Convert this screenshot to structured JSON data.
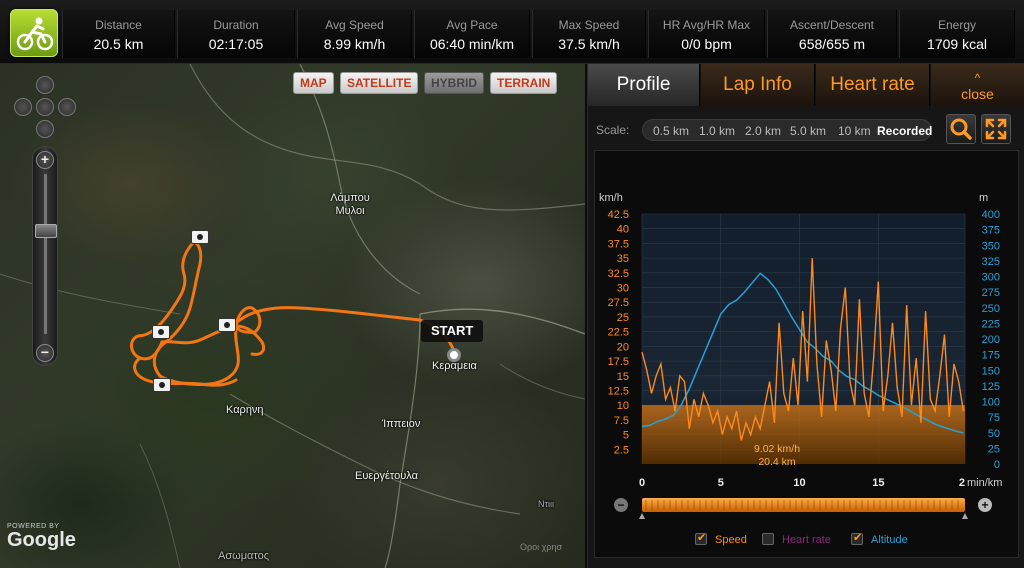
{
  "stats": [
    {
      "label": "Distance",
      "value": "20.5 km"
    },
    {
      "label": "Duration",
      "value": "02:17:05"
    },
    {
      "label": "Avg Speed",
      "value": "8.99 km/h"
    },
    {
      "label": "Avg Pace",
      "value": "06:40 min/km"
    },
    {
      "label": "Max Speed",
      "value": "37.5 km/h"
    },
    {
      "label": "HR Avg/HR Max",
      "value": "0/0 bpm"
    },
    {
      "label": "Ascent/Descent",
      "value": "658/655 m"
    },
    {
      "label": "Energy",
      "value": "1709 kcal"
    }
  ],
  "map": {
    "types": [
      "MAP",
      "SATELLITE",
      "HYBRID",
      "TERRAIN"
    ],
    "active_type": "HYBRID",
    "places": [
      "Λάμπου Μυλοι",
      "Κεραμεια",
      "Καρηνη",
      "Ίππειον",
      "Ευεργέτουλα",
      "Ντιιι",
      "Ασωματος"
    ],
    "start_label": "START",
    "powered_by": "POWERED BY",
    "google": "Google",
    "attribution": "Οροι χρησ"
  },
  "panel": {
    "tabs": [
      "Profile",
      "Lap Info",
      "Heart rate"
    ],
    "active_tab": "Profile",
    "close_label": "close",
    "close_chevron": "^",
    "scale_label": "Scale:",
    "scale_options": [
      "0.5 km",
      "1.0 km",
      "2.0 km",
      "5.0 km",
      "10 km",
      "Recorded"
    ],
    "scale_active": "Recorded"
  },
  "chart_data": {
    "type": "line",
    "left_axis_unit": "km/h",
    "right_axis_unit": "m",
    "x_axis_unit": "min/km",
    "y_ticks_left": [
      "42.5",
      "40",
      "37.5",
      "35",
      "32.5",
      "30",
      "27.5",
      "25",
      "22.5",
      "20",
      "17.5",
      "15",
      "12.5",
      "10",
      "7.5",
      "5",
      "2.5"
    ],
    "y_ticks_right": [
      "400",
      "375",
      "350",
      "325",
      "300",
      "275",
      "250",
      "225",
      "200",
      "175",
      "150",
      "125",
      "100",
      "75",
      "50",
      "25",
      "0"
    ],
    "x_ticks": [
      "0",
      "5",
      "10",
      "15",
      "2"
    ],
    "ylim_left": [
      0,
      42.5
    ],
    "ylim_right": [
      0,
      400
    ],
    "xlim": [
      0,
      20.5
    ],
    "cursor_speed": "9.02 km/h",
    "cursor_distance": "20.4 km",
    "series": [
      {
        "name": "Speed",
        "axis": "left",
        "color": "#ff8a1a",
        "x": [
          0.0,
          0.3,
          0.6,
          0.9,
          1.2,
          1.5,
          1.8,
          2.1,
          2.4,
          2.7,
          3.0,
          3.3,
          3.6,
          3.9,
          4.2,
          4.5,
          4.8,
          5.1,
          5.4,
          5.7,
          6.0,
          6.3,
          6.6,
          6.9,
          7.2,
          7.5,
          7.8,
          8.1,
          8.4,
          8.7,
          9.0,
          9.3,
          9.6,
          9.9,
          10.2,
          10.5,
          10.8,
          11.1,
          11.4,
          11.7,
          12.0,
          12.3,
          12.6,
          12.9,
          13.2,
          13.5,
          13.8,
          14.1,
          14.4,
          14.7,
          15.0,
          15.3,
          15.6,
          15.9,
          16.2,
          16.5,
          16.8,
          17.1,
          17.4,
          17.7,
          18.0,
          18.3,
          18.6,
          18.9,
          19.2,
          19.5,
          19.8,
          20.1,
          20.4
        ],
        "values": [
          19,
          16,
          12,
          15,
          17,
          11,
          13,
          9,
          15,
          14,
          6,
          11,
          8,
          12,
          10,
          7,
          9,
          5,
          8,
          6,
          9,
          4,
          7,
          5,
          8,
          6,
          10,
          14,
          7,
          24,
          12,
          9,
          18,
          10,
          26,
          14,
          35,
          17,
          8,
          21,
          16,
          9,
          23,
          30,
          14,
          10,
          28,
          12,
          8,
          18,
          31,
          9,
          15,
          24,
          13,
          8,
          27,
          10,
          18,
          7,
          26,
          11,
          9,
          15,
          22,
          8,
          17,
          14,
          9
        ]
      },
      {
        "name": "Heart rate",
        "axis": "none",
        "color": "#8a2a7a",
        "values": []
      },
      {
        "name": "Altitude",
        "axis": "right",
        "color": "#2aa0d8",
        "x": [
          0.0,
          0.5,
          1.0,
          1.5,
          2.0,
          2.5,
          3.0,
          3.5,
          4.0,
          4.5,
          5.0,
          5.5,
          6.0,
          6.5,
          7.0,
          7.5,
          8.0,
          8.5,
          9.0,
          9.5,
          10.0,
          10.5,
          11.0,
          11.5,
          12.0,
          12.5,
          13.0,
          13.5,
          14.0,
          14.5,
          15.0,
          15.5,
          16.0,
          16.5,
          17.0,
          17.5,
          18.0,
          18.5,
          19.0,
          19.5,
          20.0,
          20.4
        ],
        "values": [
          60,
          62,
          68,
          72,
          78,
          95,
          120,
          150,
          180,
          210,
          240,
          255,
          262,
          275,
          290,
          305,
          295,
          280,
          258,
          235,
          215,
          195,
          185,
          172,
          165,
          150,
          140,
          135,
          125,
          118,
          110,
          104,
          98,
          92,
          85,
          78,
          72,
          65,
          60,
          56,
          52,
          50
        ]
      }
    ]
  },
  "legend": [
    {
      "label": "Speed",
      "checked": true,
      "color": "#ff8a1a"
    },
    {
      "label": "Heart rate",
      "checked": false,
      "color": "#8a2a7a"
    },
    {
      "label": "Altitude",
      "checked": true,
      "color": "#2aa0d8"
    }
  ]
}
